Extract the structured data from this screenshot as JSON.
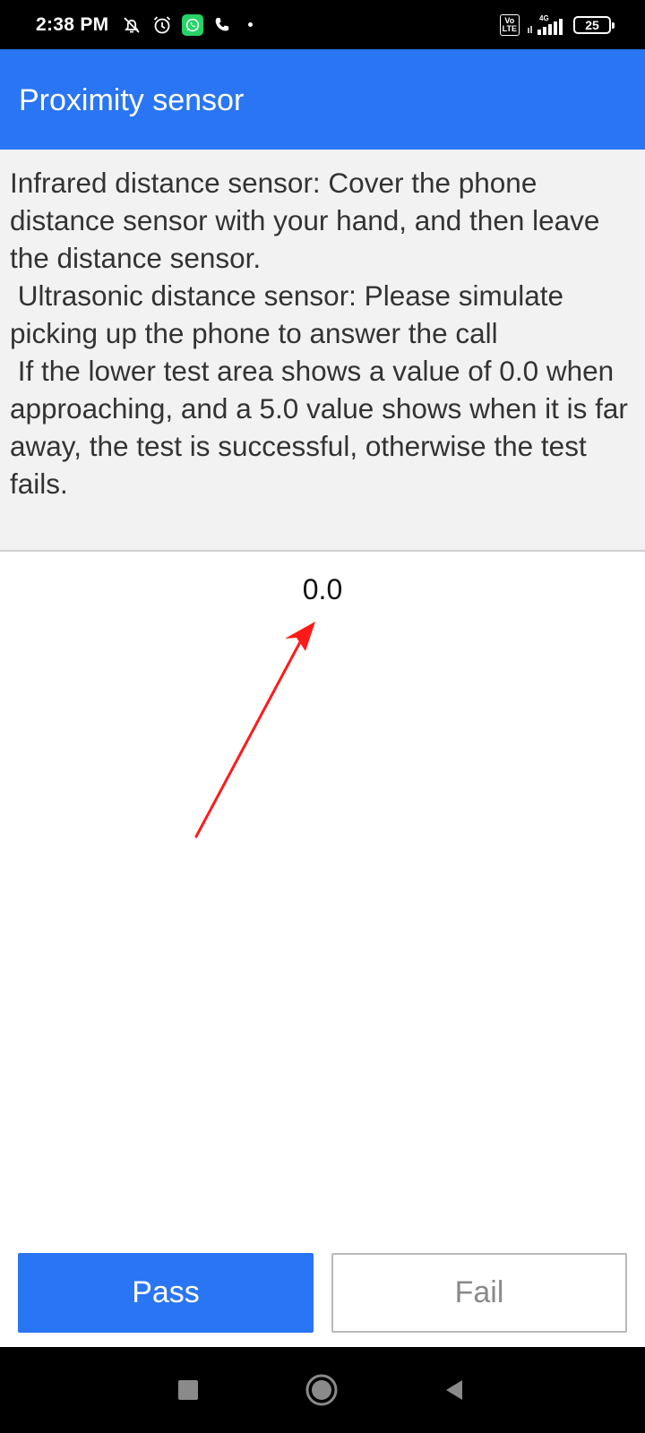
{
  "status_bar": {
    "time": "2:38 PM",
    "left_icons": [
      "notifications-off-icon",
      "alarm-icon",
      "whatsapp-icon",
      "phone-call-icon"
    ],
    "network_label": "4G",
    "volte_label": "Vo LTE",
    "battery": "25"
  },
  "app_bar": {
    "title": "Proximity sensor",
    "color": "#2a75f3"
  },
  "instructions": {
    "text": "Infrared distance sensor: Cover the phone distance sensor with your hand, and then leave the distance sensor.\n Ultrasonic distance sensor: Please simulate picking up the phone to answer the call\n If the lower test area shows a value of 0.0 when approaching, and a 5.0 value shows when it is far away, the test is successful, otherwise the test fails."
  },
  "test_area": {
    "value": "0.0",
    "annotation_arrow_color": "#ff1a1a"
  },
  "buttons": {
    "pass_label": "Pass",
    "fail_label": "Fail"
  },
  "nav_bar": {
    "icons": [
      "recents-square-icon",
      "home-circle-icon",
      "back-triangle-icon"
    ]
  }
}
